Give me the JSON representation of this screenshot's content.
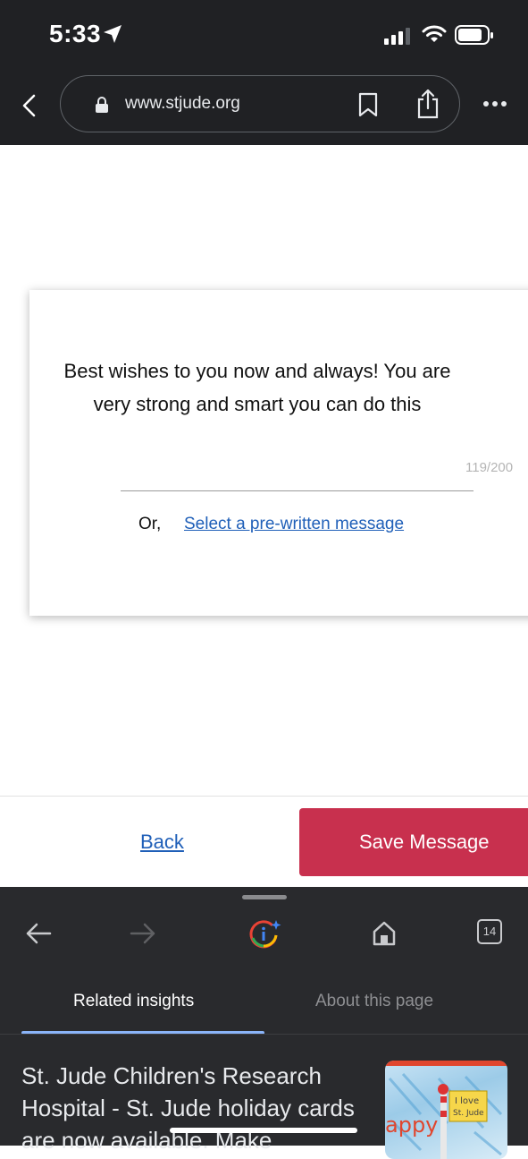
{
  "status_bar": {
    "time": "5:33"
  },
  "browser": {
    "url": "www.stjude.org"
  },
  "message_card": {
    "text": "Best wishes to you now and always! You are very strong and smart you can do this",
    "counter": "119/200",
    "or_label": "Or,",
    "prewritten_link": "Select a pre-written message"
  },
  "footer": {
    "back_label": "Back",
    "save_label": "Save Message",
    "save_color": "#c8304e"
  },
  "bottom_sheet": {
    "tab_count": "14",
    "tabs": [
      {
        "label": "Related insights",
        "active": true
      },
      {
        "label": "About this page",
        "active": false
      }
    ],
    "insight_text": "St. Jude Children's Research Hospital - St. Jude holiday cards are now available. Make",
    "thumbnail_label": "I love St. Jude",
    "thumbnail_text": "appy"
  },
  "icons": [
    "location-arrow-icon",
    "signal-icon",
    "wifi-icon",
    "battery-icon",
    "back-icon",
    "lock-icon",
    "bookmark-icon",
    "share-icon",
    "more-icon",
    "arrow-left-icon",
    "arrow-right-icon",
    "google-insights-icon",
    "home-icon"
  ]
}
